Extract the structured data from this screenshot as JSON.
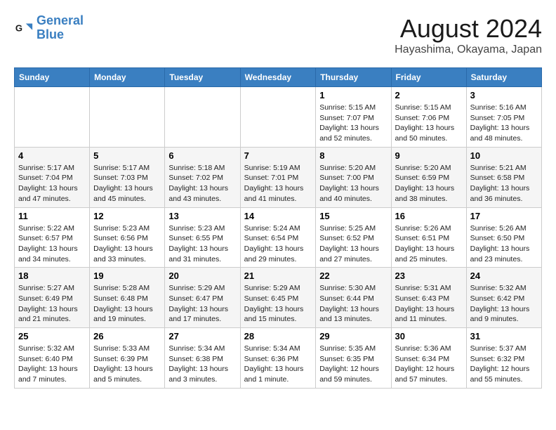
{
  "logo": {
    "line1": "General",
    "line2": "Blue"
  },
  "title": "August 2024",
  "location": "Hayashima, Okayama, Japan",
  "weekdays": [
    "Sunday",
    "Monday",
    "Tuesday",
    "Wednesday",
    "Thursday",
    "Friday",
    "Saturday"
  ],
  "weeks": [
    [
      {
        "day": "",
        "info": ""
      },
      {
        "day": "",
        "info": ""
      },
      {
        "day": "",
        "info": ""
      },
      {
        "day": "",
        "info": ""
      },
      {
        "day": "1",
        "info": "Sunrise: 5:15 AM\nSunset: 7:07 PM\nDaylight: 13 hours\nand 52 minutes."
      },
      {
        "day": "2",
        "info": "Sunrise: 5:15 AM\nSunset: 7:06 PM\nDaylight: 13 hours\nand 50 minutes."
      },
      {
        "day": "3",
        "info": "Sunrise: 5:16 AM\nSunset: 7:05 PM\nDaylight: 13 hours\nand 48 minutes."
      }
    ],
    [
      {
        "day": "4",
        "info": "Sunrise: 5:17 AM\nSunset: 7:04 PM\nDaylight: 13 hours\nand 47 minutes."
      },
      {
        "day": "5",
        "info": "Sunrise: 5:17 AM\nSunset: 7:03 PM\nDaylight: 13 hours\nand 45 minutes."
      },
      {
        "day": "6",
        "info": "Sunrise: 5:18 AM\nSunset: 7:02 PM\nDaylight: 13 hours\nand 43 minutes."
      },
      {
        "day": "7",
        "info": "Sunrise: 5:19 AM\nSunset: 7:01 PM\nDaylight: 13 hours\nand 41 minutes."
      },
      {
        "day": "8",
        "info": "Sunrise: 5:20 AM\nSunset: 7:00 PM\nDaylight: 13 hours\nand 40 minutes."
      },
      {
        "day": "9",
        "info": "Sunrise: 5:20 AM\nSunset: 6:59 PM\nDaylight: 13 hours\nand 38 minutes."
      },
      {
        "day": "10",
        "info": "Sunrise: 5:21 AM\nSunset: 6:58 PM\nDaylight: 13 hours\nand 36 minutes."
      }
    ],
    [
      {
        "day": "11",
        "info": "Sunrise: 5:22 AM\nSunset: 6:57 PM\nDaylight: 13 hours\nand 34 minutes."
      },
      {
        "day": "12",
        "info": "Sunrise: 5:23 AM\nSunset: 6:56 PM\nDaylight: 13 hours\nand 33 minutes."
      },
      {
        "day": "13",
        "info": "Sunrise: 5:23 AM\nSunset: 6:55 PM\nDaylight: 13 hours\nand 31 minutes."
      },
      {
        "day": "14",
        "info": "Sunrise: 5:24 AM\nSunset: 6:54 PM\nDaylight: 13 hours\nand 29 minutes."
      },
      {
        "day": "15",
        "info": "Sunrise: 5:25 AM\nSunset: 6:52 PM\nDaylight: 13 hours\nand 27 minutes."
      },
      {
        "day": "16",
        "info": "Sunrise: 5:26 AM\nSunset: 6:51 PM\nDaylight: 13 hours\nand 25 minutes."
      },
      {
        "day": "17",
        "info": "Sunrise: 5:26 AM\nSunset: 6:50 PM\nDaylight: 13 hours\nand 23 minutes."
      }
    ],
    [
      {
        "day": "18",
        "info": "Sunrise: 5:27 AM\nSunset: 6:49 PM\nDaylight: 13 hours\nand 21 minutes."
      },
      {
        "day": "19",
        "info": "Sunrise: 5:28 AM\nSunset: 6:48 PM\nDaylight: 13 hours\nand 19 minutes."
      },
      {
        "day": "20",
        "info": "Sunrise: 5:29 AM\nSunset: 6:47 PM\nDaylight: 13 hours\nand 17 minutes."
      },
      {
        "day": "21",
        "info": "Sunrise: 5:29 AM\nSunset: 6:45 PM\nDaylight: 13 hours\nand 15 minutes."
      },
      {
        "day": "22",
        "info": "Sunrise: 5:30 AM\nSunset: 6:44 PM\nDaylight: 13 hours\nand 13 minutes."
      },
      {
        "day": "23",
        "info": "Sunrise: 5:31 AM\nSunset: 6:43 PM\nDaylight: 13 hours\nand 11 minutes."
      },
      {
        "day": "24",
        "info": "Sunrise: 5:32 AM\nSunset: 6:42 PM\nDaylight: 13 hours\nand 9 minutes."
      }
    ],
    [
      {
        "day": "25",
        "info": "Sunrise: 5:32 AM\nSunset: 6:40 PM\nDaylight: 13 hours\nand 7 minutes."
      },
      {
        "day": "26",
        "info": "Sunrise: 5:33 AM\nSunset: 6:39 PM\nDaylight: 13 hours\nand 5 minutes."
      },
      {
        "day": "27",
        "info": "Sunrise: 5:34 AM\nSunset: 6:38 PM\nDaylight: 13 hours\nand 3 minutes."
      },
      {
        "day": "28",
        "info": "Sunrise: 5:34 AM\nSunset: 6:36 PM\nDaylight: 13 hours\nand 1 minute."
      },
      {
        "day": "29",
        "info": "Sunrise: 5:35 AM\nSunset: 6:35 PM\nDaylight: 12 hours\nand 59 minutes."
      },
      {
        "day": "30",
        "info": "Sunrise: 5:36 AM\nSunset: 6:34 PM\nDaylight: 12 hours\nand 57 minutes."
      },
      {
        "day": "31",
        "info": "Sunrise: 5:37 AM\nSunset: 6:32 PM\nDaylight: 12 hours\nand 55 minutes."
      }
    ]
  ]
}
